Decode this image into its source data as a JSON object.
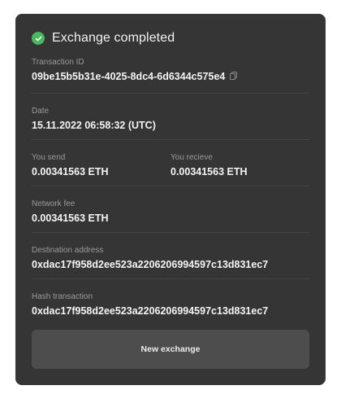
{
  "header": {
    "title": "Exchange completed",
    "status_color": "#4ab85e"
  },
  "transaction_id": {
    "label": "Transaction ID",
    "value": "09be15b5b31e-4025-8dc4-6d6344c575e4",
    "copy_icon": "copy-icon"
  },
  "date": {
    "label": "Date",
    "value": "15.11.2022 06:58:32 (UTC)"
  },
  "you_send": {
    "label": "You send",
    "value": "0.00341563 ETH"
  },
  "you_receive": {
    "label": "You recieve",
    "value": "0.00341563 ETH"
  },
  "network_fee": {
    "label": "Network fee",
    "value": "0.00341563 ETH"
  },
  "destination_address": {
    "label": "Destination address",
    "value": "0xdac17f958d2ee523a2206206994597c13d831ec7"
  },
  "hash_transaction": {
    "label": "Hash transaction",
    "value": "0xdac17f958d2ee523a2206206994597c13d831ec7"
  },
  "actions": {
    "new_exchange_label": "New exchange"
  }
}
